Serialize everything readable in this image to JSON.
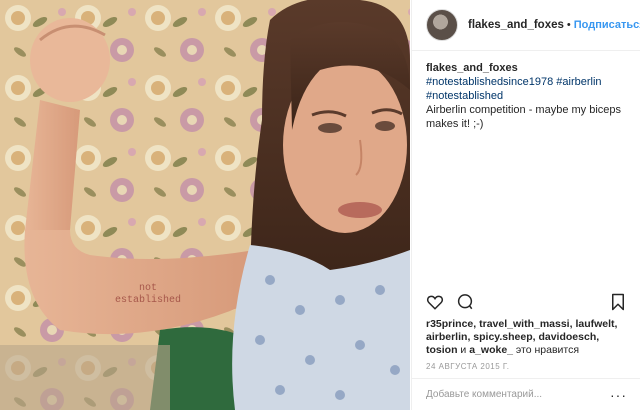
{
  "post": {
    "image_alt": "Woman flexing arm with 'not established' tattoo",
    "tattoo_text_line1": "not",
    "tattoo_text_line2": "established"
  },
  "header": {
    "username": "flakes_and_foxes",
    "separator": "•",
    "follow_label": "Подписаться"
  },
  "caption": {
    "username": "flakes_and_foxes",
    "hashtags": [
      "#notestablishedsince1978",
      "#airberlin",
      "#notestablished"
    ],
    "text": "Airberlin competition - maybe my biceps makes it! ;-)"
  },
  "actions": {
    "like_icon": "heart-icon",
    "comment_icon": "comment-icon",
    "save_icon": "bookmark-icon"
  },
  "likes": {
    "users": [
      "r35prince",
      "travel_with_massi",
      "laufwelt",
      "airberlin",
      "spicy.sheep",
      "davidoesch",
      "tosion",
      "a_woke_"
    ],
    "connector": "и",
    "suffix": "это нравится"
  },
  "date": "24 АВГУСТА 2015 Г.",
  "comment": {
    "placeholder": "Добавьте комментарий...",
    "more_icon": "more-options-icon"
  },
  "colors": {
    "link_blue": "#3897f0",
    "hashtag": "#003569",
    "muted": "#999999",
    "border": "#efefef"
  }
}
